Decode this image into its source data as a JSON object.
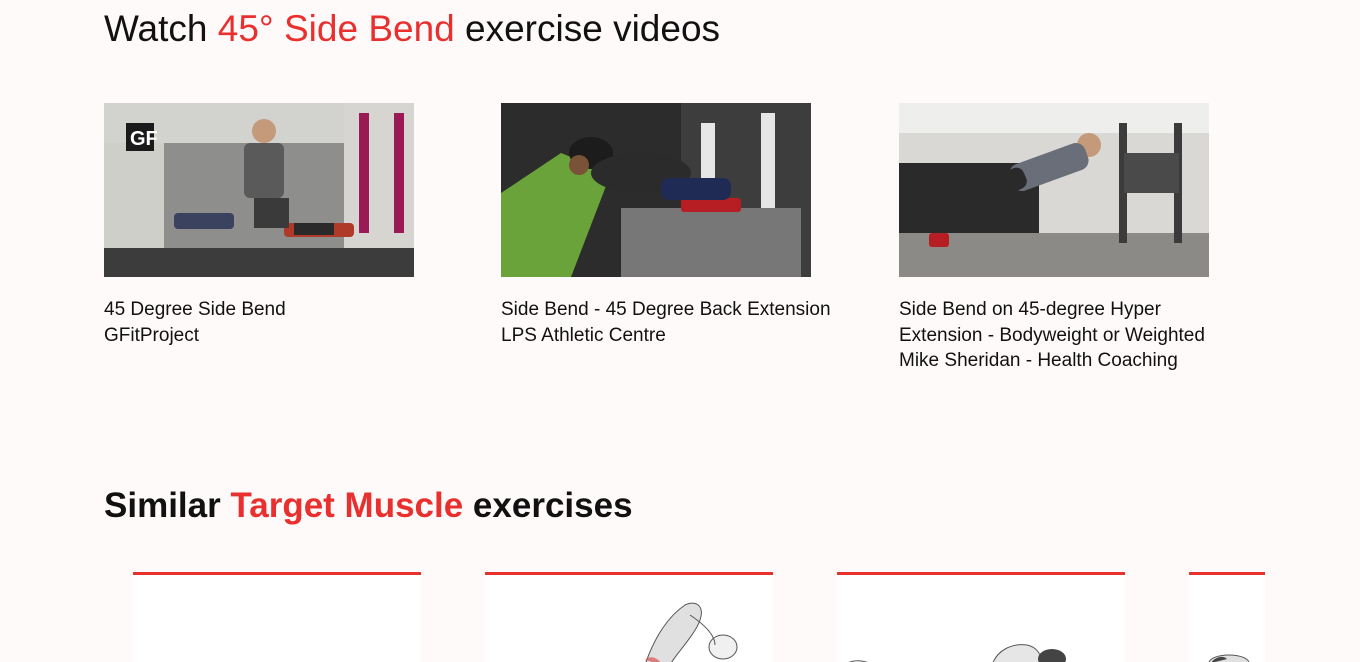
{
  "videos_section": {
    "title_prefix": "Watch ",
    "title_highlight": "45° Side Bend",
    "title_suffix": " exercise videos"
  },
  "videos": [
    {
      "title": "45 Degree Side Bend",
      "channel": "GFitProject"
    },
    {
      "title": "Side Bend - 45 Degree Back Extension",
      "channel": "LPS Athletic Centre"
    },
    {
      "title": "Side Bend on 45-degree Hyper Extension - Bodyweight or Weighted",
      "channel": "Mike Sheridan - Health Coaching"
    }
  ],
  "similar_section": {
    "title_prefix": "Similar ",
    "title_highlight": "Target Muscle",
    "title_suffix": " exercises"
  },
  "colors": {
    "accent": "#e8302e",
    "background": "#fffafa",
    "text": "#111111"
  },
  "similar_cards": [
    {
      "icon": "exercise-illustration-blank"
    },
    {
      "icon": "exercise-illustration-side-plank"
    },
    {
      "icon": "exercise-illustration-lying"
    },
    {
      "icon": "exercise-illustration-partial"
    }
  ]
}
